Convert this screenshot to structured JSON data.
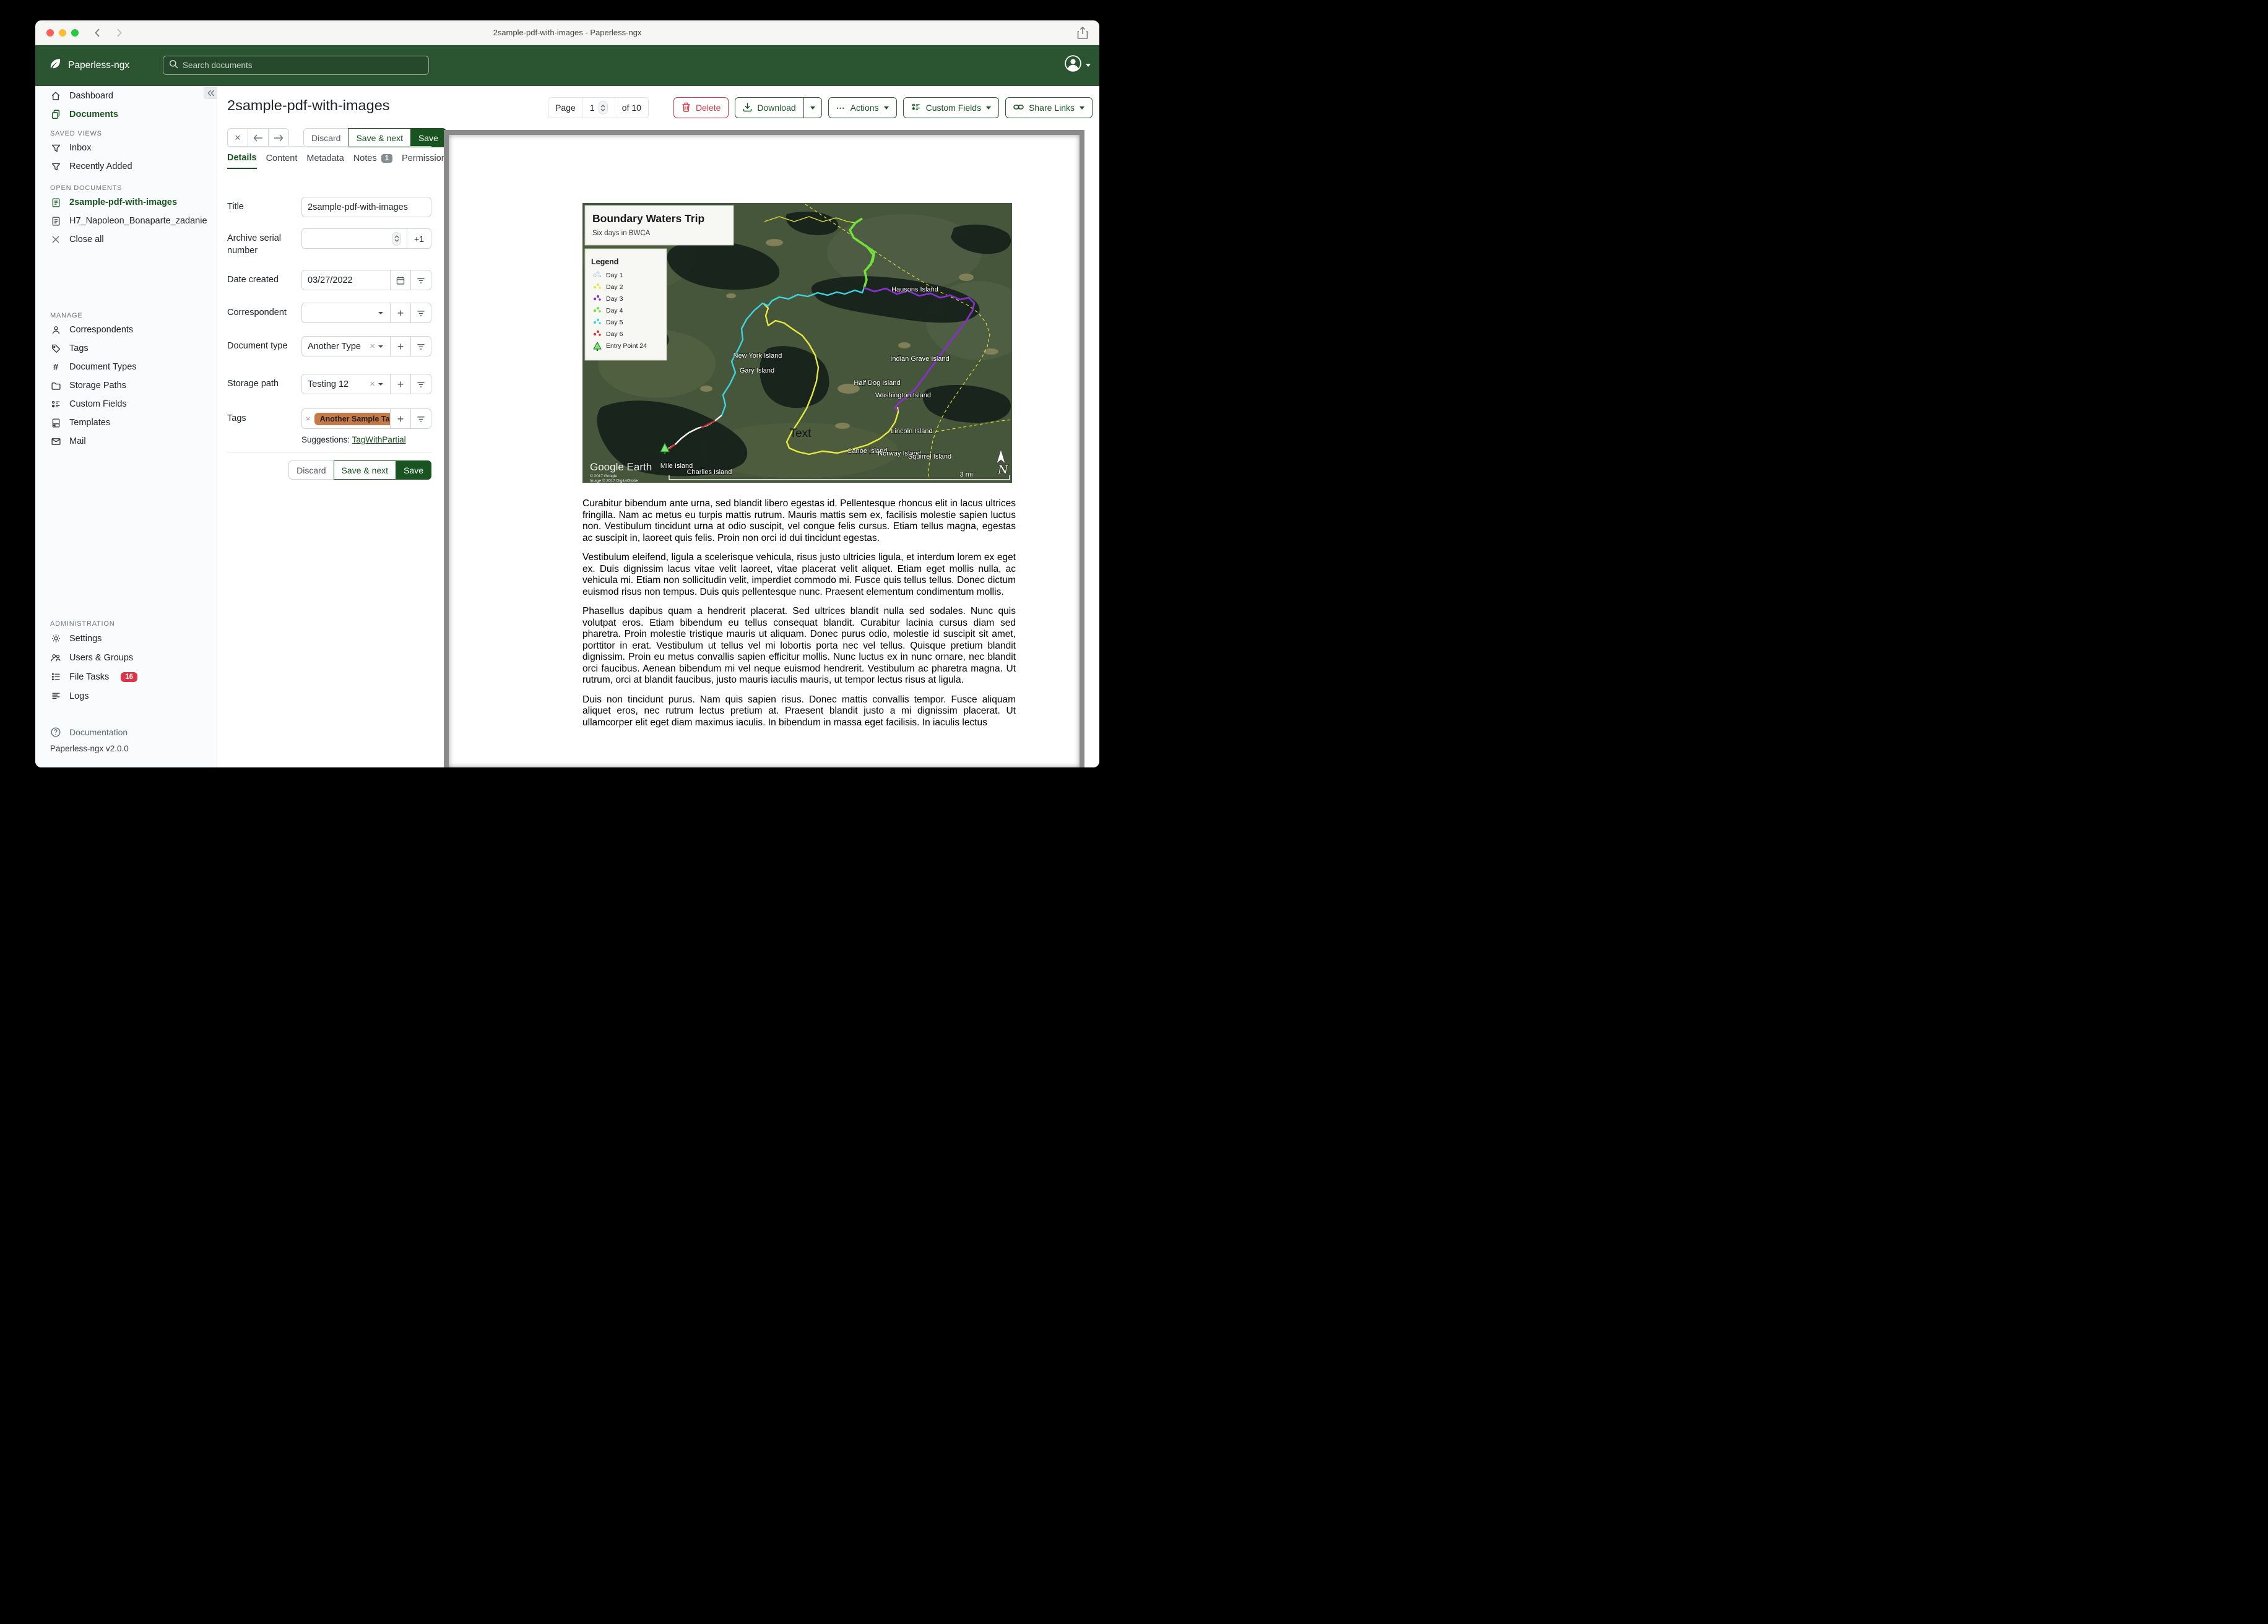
{
  "colors": {
    "accent_green": "#17541f",
    "header_green": "#2b5430",
    "danger_red": "#dc3545",
    "tag_orange": "#c67a4a",
    "viewer_frame_gray": "#8a8a8a"
  },
  "window": {
    "title": "2sample-pdf-with-images - Paperless-ngx"
  },
  "header": {
    "brand": "Paperless-ngx",
    "search_placeholder": "Search documents"
  },
  "sidebar": {
    "sections": {
      "saved_views": "SAVED VIEWS",
      "open_documents": "OPEN DOCUMENTS",
      "manage": "MANAGE",
      "administration": "ADMINISTRATION"
    },
    "items": {
      "dashboard": "Dashboard",
      "documents": "Documents",
      "inbox": "Inbox",
      "recently_added": "Recently Added",
      "open_doc_1": "2sample-pdf-with-images",
      "open_doc_2": "H7_Napoleon_Bonaparte_zadanie",
      "close_all": "Close all",
      "correspondents": "Correspondents",
      "tags": "Tags",
      "document_types": "Document Types",
      "storage_paths": "Storage Paths",
      "custom_fields": "Custom Fields",
      "templates": "Templates",
      "mail": "Mail",
      "settings": "Settings",
      "users_groups": "Users & Groups",
      "file_tasks": "File Tasks",
      "logs": "Logs",
      "documentation": "Documentation"
    },
    "file_tasks_count": "16",
    "version": "Paperless-ngx v2.0.0"
  },
  "toolbar": {
    "page_label": "Page",
    "page_value": "1",
    "page_total": "of 10",
    "delete": "Delete",
    "download": "Download",
    "actions": "Actions",
    "custom_fields": "Custom Fields",
    "share_links": "Share Links"
  },
  "document": {
    "title": "2sample-pdf-with-images",
    "discard": "Discard",
    "save_next": "Save & next",
    "save": "Save"
  },
  "tabs": {
    "details": "Details",
    "content": "Content",
    "metadata": "Metadata",
    "notes": "Notes",
    "notes_count": "1",
    "permissions": "Permissions"
  },
  "form": {
    "title_label": "Title",
    "title_value": "2sample-pdf-with-images",
    "asn_label": "Archive serial number",
    "asn_increment": "+1",
    "date_created_label": "Date created",
    "date_created_value": "03/27/2022",
    "correspondent_label": "Correspondent",
    "document_type_label": "Document type",
    "document_type_value": "Another Type",
    "storage_path_label": "Storage path",
    "storage_path_value": "Testing 12",
    "tags_label": "Tags",
    "tag_value": "Another Sample Tag",
    "suggestions_label": "Suggestions:",
    "suggestion_link": "TagWithPartial"
  },
  "preview": {
    "map": {
      "title": "Boundary Waters Trip",
      "subtitle": "Six days in BWCA",
      "legend_title": "Legend",
      "legend": [
        {
          "label": "Day 1",
          "color": "#e8f4f8"
        },
        {
          "label": "Day 2",
          "color": "#e6e93f"
        },
        {
          "label": "Day 3",
          "color": "#8730c9"
        },
        {
          "label": "Day 4",
          "color": "#71e03a"
        },
        {
          "label": "Day 5",
          "color": "#3fd4e0"
        },
        {
          "label": "Day 6",
          "color": "#cc2f2f"
        },
        {
          "label": "Entry Point 24",
          "color": "#58d068"
        }
      ],
      "labels": [
        "Hausons Island",
        "New York Island",
        "Gary Island",
        "Indian Grave Island",
        "Half Dog Island",
        "Washington Island",
        "Lincoln Island",
        "Canoe Island",
        "Norway Island",
        "Squirrel Island",
        "Mile Island",
        "Charlies Island"
      ],
      "annotation": "Text",
      "watermark": "Google Earth",
      "copyright1": "© 2017 Google",
      "copyright2": "Image © 2017 DigitalGlobe",
      "scale": "3 mi",
      "north": "N"
    },
    "paragraphs": [
      "Curabitur bibendum ante urna, sed blandit libero egestas id. Pellentesque rhoncus elit in lacus ultrices fringilla. Nam ac metus eu turpis mattis rutrum. Mauris mattis sem ex, facilisis molestie sapien luctus non. Vestibulum tincidunt urna at odio suscipit, vel congue felis cursus. Etiam tellus magna, egestas ac suscipit in, laoreet quis felis. Proin non orci id dui tincidunt egestas.",
      "Vestibulum eleifend, ligula a scelerisque vehicula, risus justo ultricies ligula, et interdum lorem ex eget ex. Duis dignissim lacus vitae velit laoreet, vitae placerat velit aliquet. Etiam eget mollis nulla, ac vehicula mi. Etiam non sollicitudin velit, imperdiet commodo mi. Fusce quis tellus tellus. Donec dictum euismod risus non tempus. Duis quis pellentesque nunc. Praesent elementum condimentum mollis.",
      "Phasellus dapibus quam a hendrerit placerat. Sed ultrices blandit nulla sed sodales. Nunc quis volutpat eros. Etiam bibendum eu tellus consequat blandit. Curabitur lacinia cursus diam sed pharetra. Proin molestie tristique mauris ut aliquam. Donec purus odio, molestie id suscipit sit amet, porttitor in erat. Vestibulum ut tellus vel mi lobortis porta nec vel tellus. Quisque pretium blandit dignissim. Proin eu metus convallis sapien efficitur mollis. Nunc luctus ex in nunc ornare, nec blandit orci faucibus. Aenean bibendum mi vel neque euismod hendrerit. Vestibulum ac pharetra magna. Ut rutrum, orci at blandit faucibus, justo mauris iaculis mauris, ut tempor lectus risus at ligula.",
      "Duis non tincidunt purus. Nam quis sapien risus. Donec mattis convallis tempor. Fusce aliquam aliquet eros, nec rutrum lectus pretium at. Praesent blandit justo a mi dignissim placerat. Ut ullamcorper elit eget diam maximus iaculis. In bibendum in massa eget facilisis. In iaculis lectus"
    ]
  }
}
